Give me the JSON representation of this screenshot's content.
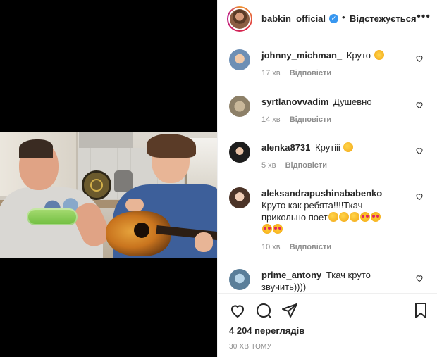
{
  "post": {
    "username": "babkin_official",
    "verified_icon": "verified-badge-icon",
    "separator": "•",
    "follow_label": "Відстежується",
    "more_icon": "more-options-icon",
    "more_label": "•••"
  },
  "comments": [
    {
      "username": "johnny_michman_",
      "text": "Круто",
      "emojis": [
        "wow"
      ],
      "time": "17 хв",
      "reply_label": "Відповісти"
    },
    {
      "username": "syrtlanovvadim",
      "text": "Душевно",
      "emojis": [],
      "time": "14 хв",
      "reply_label": "Відповісти"
    },
    {
      "username": "alenka8731",
      "text": "Крутііі",
      "emojis": [
        "clap"
      ],
      "time": "5 хв",
      "reply_label": "Відповісти"
    },
    {
      "username": "aleksandrapushinababenko",
      "text_line1": "Круто как ребята!!!!Ткач",
      "text_line2": "прикольно поет",
      "emojis_line2": [
        "clap",
        "clap",
        "clap",
        "love",
        "love"
      ],
      "emojis_line3": [
        "love",
        "love"
      ],
      "time": "10 хв",
      "reply_label": "Відповісти"
    },
    {
      "username": "prime_antony",
      "text": "Ткач круто",
      "text_line2": "звучить))))",
      "emojis": []
    }
  ],
  "footer": {
    "views": "4 204 переглядів",
    "time": "30 ХВ ТОМУ"
  },
  "colors": {
    "text": "#262626",
    "muted": "#8e8e8e",
    "verified": "#3897f0",
    "border": "#efefef"
  }
}
